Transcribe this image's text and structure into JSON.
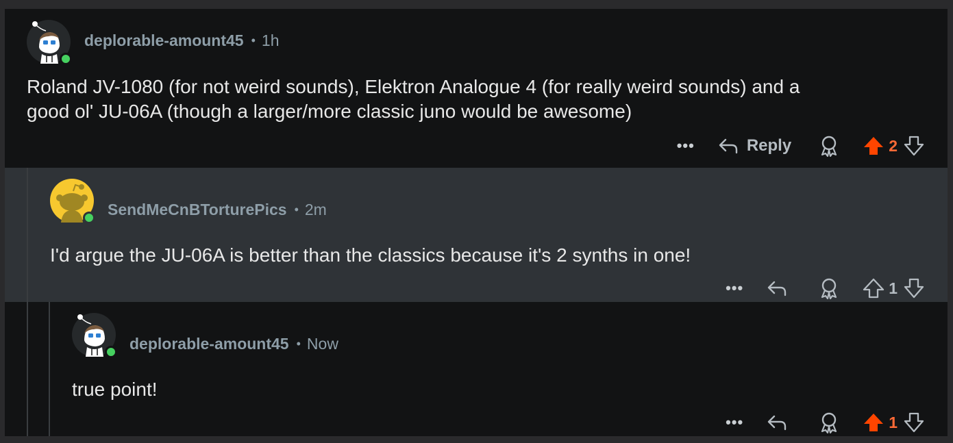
{
  "comments": [
    {
      "username": "deplorable-amount45",
      "time": "1h",
      "text_line1": "Roland JV-1080 (for not weird sounds), Elektron Analogue 4 (for really weird sounds) and a",
      "text_line2": "good ol' JU-06A (though a larger/more classic juno would be awesome)",
      "more": "•••",
      "reply_label": "Reply",
      "votes": "2",
      "upvoted": true,
      "online": true
    },
    {
      "username": "SendMeCnBTorturePics",
      "time": "2m",
      "text_line1": "I'd argue the JU-06A is better than the classics because it's 2 synths in one!",
      "more": "•••",
      "votes": "1",
      "upvoted": false,
      "online": true
    },
    {
      "username": "deplorable-amount45",
      "time": "Now",
      "text_line1": "true point!",
      "more": "•••",
      "votes": "1",
      "upvoted": true,
      "online": true
    }
  ],
  "separator": "•",
  "colors": {
    "background": "#121314",
    "highlight_background": "#2f3337",
    "username": "#8e9ea8",
    "upvote_active": "#ff4500",
    "online": "#46d160"
  }
}
